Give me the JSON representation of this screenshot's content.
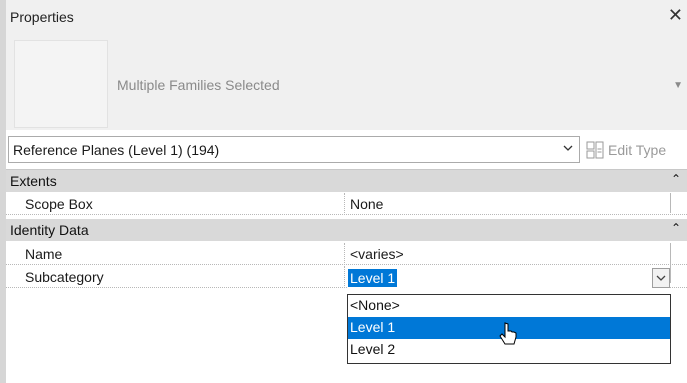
{
  "panel": {
    "title": "Properties",
    "close_icon": "close-icon"
  },
  "type_selector": {
    "family_label": "Multiple Families Selected",
    "selected_type": "Reference Planes (Level 1) (194)"
  },
  "toolbar": {
    "edit_type_label": "Edit Type",
    "edit_type_icon": "edit-type-icon"
  },
  "groups": {
    "extents": {
      "label": "Extents",
      "collapse_icon": "collapse-chevron-icon"
    },
    "identity": {
      "label": "Identity Data",
      "collapse_icon": "collapse-chevron-icon"
    }
  },
  "properties": {
    "scope_box": {
      "label": "Scope Box",
      "value": "None"
    },
    "name": {
      "label": "Name",
      "value": "<varies>"
    },
    "subcategory": {
      "label": "Subcategory",
      "value": "Level 1"
    }
  },
  "dropdown": {
    "options": [
      "<None>",
      "Level 1",
      "Level 2"
    ],
    "highlighted": "Level 1"
  },
  "colors": {
    "selection": "#0078d7",
    "group_bg": "#d9d9d9",
    "header_bg": "#f0f0f0"
  }
}
